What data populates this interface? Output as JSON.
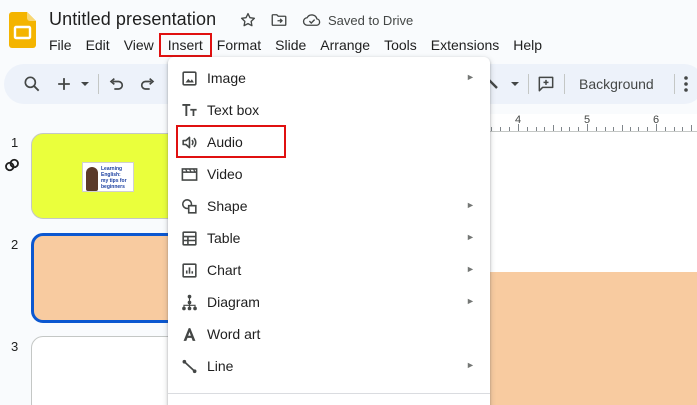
{
  "app": {
    "doc_title": "Untitled presentation",
    "save_status": "Saved to Drive"
  },
  "menubar": {
    "items": [
      "File",
      "Edit",
      "View",
      "Insert",
      "Format",
      "Slide",
      "Arrange",
      "Tools",
      "Extensions",
      "Help"
    ],
    "open_item": "Insert"
  },
  "toolbar": {
    "background_label": "Background"
  },
  "ruler": {
    "numbers": [
      "4",
      "5",
      "6"
    ]
  },
  "filmstrip": {
    "slide_numbers": [
      "1",
      "2",
      "3"
    ],
    "slide1_thumb_text": [
      "Learning English:",
      "my tips for",
      "beginners"
    ],
    "selected_slide": "2"
  },
  "insert_menu": {
    "items": [
      {
        "label": "Image",
        "icon": "image-icon",
        "submenu": true
      },
      {
        "label": "Text box",
        "icon": "text-box-icon",
        "submenu": false
      },
      {
        "label": "Audio",
        "icon": "audio-icon",
        "submenu": false
      },
      {
        "label": "Video",
        "icon": "video-icon",
        "submenu": false
      },
      {
        "label": "Shape",
        "icon": "shape-icon",
        "submenu": true
      },
      {
        "label": "Table",
        "icon": "table-icon",
        "submenu": true
      },
      {
        "label": "Chart",
        "icon": "chart-icon",
        "submenu": true
      },
      {
        "label": "Diagram",
        "icon": "diagram-icon",
        "submenu": true
      },
      {
        "label": "Word art",
        "icon": "word-art-icon",
        "submenu": false
      },
      {
        "label": "Line",
        "icon": "line-icon",
        "submenu": true
      }
    ],
    "submenu_glyph": "►"
  },
  "colors": {
    "slide1_bg": "#eaff3c",
    "slide2_bg": "#f8cba0",
    "selection_blue": "#0b57d0",
    "annotation_red": "#e01010",
    "logo_yellow": "#f4b400"
  }
}
